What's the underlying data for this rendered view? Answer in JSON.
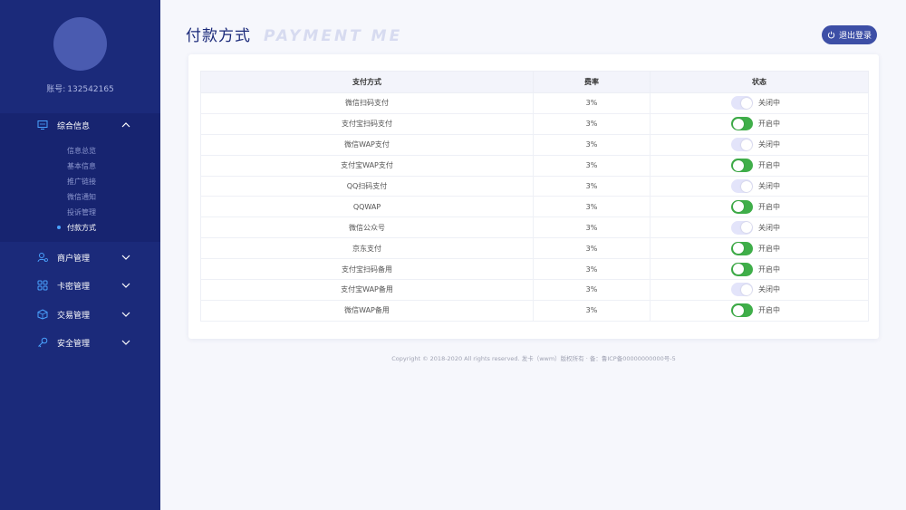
{
  "sidebar": {
    "account_label": "账号:",
    "account_value": "132542165",
    "menu": [
      {
        "label": "综合信息",
        "icon": "monitor-icon",
        "expanded": true
      },
      {
        "label": "商户管理",
        "icon": "users-icon"
      },
      {
        "label": "卡密管理",
        "icon": "grid-icon"
      },
      {
        "label": "交易管理",
        "icon": "box-icon"
      },
      {
        "label": "安全管理",
        "icon": "key-icon"
      }
    ],
    "submenu": [
      {
        "label": "信息总览"
      },
      {
        "label": "基本信息"
      },
      {
        "label": "推广链接"
      },
      {
        "label": "微信通知"
      },
      {
        "label": "投诉管理"
      },
      {
        "label": "付款方式",
        "active": true
      }
    ]
  },
  "header": {
    "title": "付款方式",
    "subtitle": "PAYMENT ME",
    "logout_label": "退出登录"
  },
  "table": {
    "columns": [
      "支付方式",
      "费率",
      "状态"
    ],
    "rows": [
      {
        "method": "微信扫码支付",
        "rate": "3%",
        "on": false,
        "status": "关闭中"
      },
      {
        "method": "支付宝扫码支付",
        "rate": "3%",
        "on": true,
        "status": "开启中"
      },
      {
        "method": "微信WAP支付",
        "rate": "3%",
        "on": false,
        "status": "关闭中"
      },
      {
        "method": "支付宝WAP支付",
        "rate": "3%",
        "on": true,
        "status": "开启中"
      },
      {
        "method": "QQ扫码支付",
        "rate": "3%",
        "on": false,
        "status": "关闭中"
      },
      {
        "method": "QQWAP",
        "rate": "3%",
        "on": true,
        "status": "开启中"
      },
      {
        "method": "微信公众号",
        "rate": "3%",
        "on": false,
        "status": "关闭中"
      },
      {
        "method": "京东支付",
        "rate": "3%",
        "on": true,
        "status": "开启中"
      },
      {
        "method": "支付宝扫码备用",
        "rate": "3%",
        "on": true,
        "status": "开启中"
      },
      {
        "method": "支付宝WAP备用",
        "rate": "3%",
        "on": false,
        "status": "关闭中"
      },
      {
        "method": "微信WAP备用",
        "rate": "3%",
        "on": true,
        "status": "开启中"
      }
    ]
  },
  "footer": {
    "copyright": "Copyright © 2018-2020 All rights reserved. 发卡（wwm）版权所有 · 备：鲁ICP备00000000000号-5"
  },
  "colors": {
    "sidebar_bg": "#1b2a7a",
    "accent": "#3d4fa6",
    "toggle_on": "#3fae49",
    "toggle_off": "#e3e4fa"
  }
}
